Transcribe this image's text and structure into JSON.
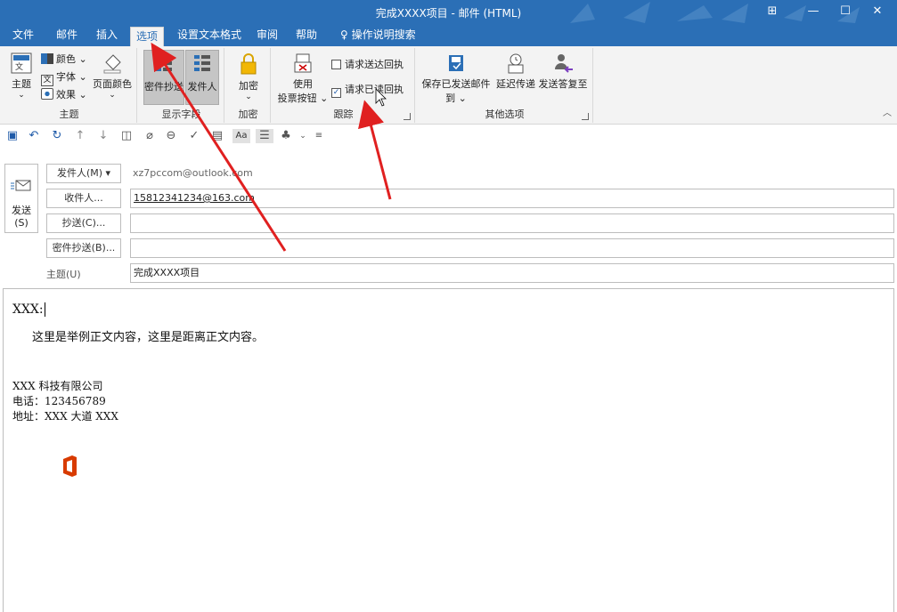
{
  "window": {
    "title": "完成XXXX项目  -  邮件 (HTML)",
    "buttons": [
      "⊞",
      "—",
      "☐",
      "✕"
    ]
  },
  "tabs": [
    "文件",
    "邮件",
    "插入",
    "选项",
    "设置文本格式",
    "审阅",
    "帮助",
    "操作说明搜索"
  ],
  "ribbon": {
    "theme_group": {
      "label": "主题",
      "theme_btn": "主题",
      "colors": "颜色",
      "fonts": "字体",
      "effects": "效果",
      "page_color": "页面颜色"
    },
    "fields_group": {
      "label": "显示字段",
      "bcc": "密件抄送",
      "from": "发件人"
    },
    "encrypt_group": {
      "label": "加密",
      "encrypt": "加密"
    },
    "tracking_group": {
      "label": "跟踪",
      "voting_line1": "使用",
      "voting_line2": "投票按钮",
      "delivery_receipt": "请求送达回执",
      "read_receipt": "请求已读回执"
    },
    "more_group": {
      "label": "其他选项",
      "save_sent": "保存已发送邮件",
      "save_sent_to": "到",
      "delay": "延迟传递",
      "reply_to": "发送答复至"
    }
  },
  "form": {
    "send_line1": "发送",
    "send_line2": "(S)",
    "from_btn": "发件人(M) ▾",
    "from_value": "xz7pccom@outlook.com",
    "to_btn": "收件人...",
    "to_value": "15812341234@163.com",
    "cc_btn": "抄送(C)...",
    "cc_value": "",
    "bcc_btn": "密件抄送(B)...",
    "bcc_value": "",
    "subject_label": "主题(U)",
    "subject_value": "完成XXXX项目"
  },
  "body": {
    "greeting": "XXX:",
    "content": "这里是举例正文内容，这里是距离正文内容。",
    "sig_company": "XXX 科技有限公司",
    "sig_phone": "电话：123456789",
    "sig_address": "地址：XXX 大道 XXX"
  },
  "colors": {
    "accent": "#2b6fb6",
    "arrow": "#e02020",
    "office_logo": "#d83b01"
  }
}
